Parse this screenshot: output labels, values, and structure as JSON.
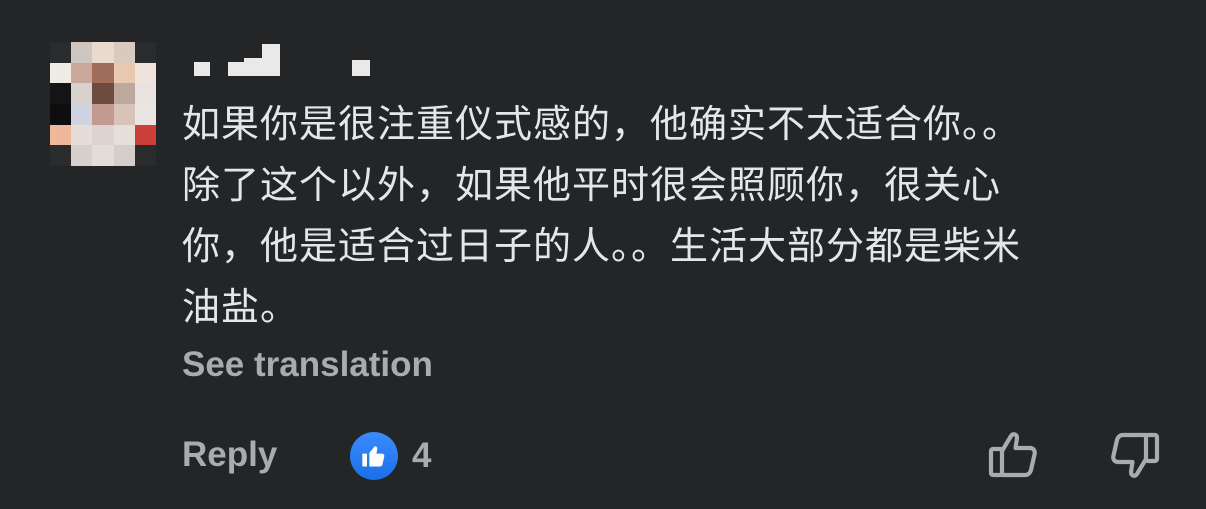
{
  "comment": {
    "author_name": "",
    "lines": [
      "如果你是很注重仪式感的，他确实不太适合你。。",
      "除了这个以外，如果他平时很会照顾你，很关心",
      "你，他是适合过日子的人。。生活大部分都是柴米",
      "油盐。"
    ],
    "see_translation_label": "See translation"
  },
  "actions": {
    "reply_label": "Reply",
    "reaction_icon": "like-icon",
    "reaction_count": "4",
    "upvote_icon": "thumbs-up-outline-icon",
    "downvote_icon": "thumbs-down-outline-icon"
  },
  "colors": {
    "background": "#242526",
    "text_primary": "#e4e6eb",
    "text_secondary": "#a8abaf",
    "like_blue": "#1a6fe8"
  }
}
